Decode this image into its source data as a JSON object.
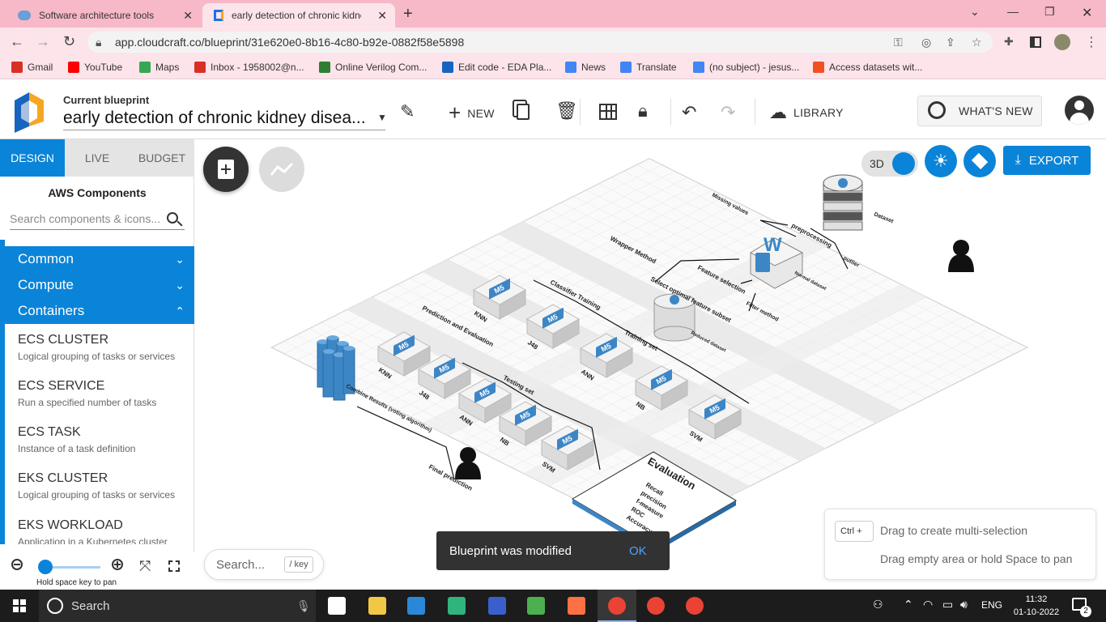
{
  "browser": {
    "tabs": [
      {
        "title": "Software architecture tools",
        "active": false
      },
      {
        "title": "early detection of chronic kidney",
        "active": true
      }
    ],
    "url": "app.cloudcraft.co/blueprint/31e620e0-8b16-4c80-b92e-0882f58e5898",
    "bookmarks": [
      {
        "label": "Gmail",
        "color": "#d93025"
      },
      {
        "label": "YouTube",
        "color": "#ff0000"
      },
      {
        "label": "Maps",
        "color": "#34a853"
      },
      {
        "label": "Inbox - 1958002@n...",
        "color": "#d93025"
      },
      {
        "label": "Online Verilog Com...",
        "color": "#2e7d32"
      },
      {
        "label": "Edit code - EDA Pla...",
        "color": "#1565c0"
      },
      {
        "label": "News",
        "color": "#4285f4"
      },
      {
        "label": "Translate",
        "color": "#4285f4"
      },
      {
        "label": "(no subject) - jesus...",
        "color": "#4285f4"
      },
      {
        "label": "Access datasets wit...",
        "color": "#f25022"
      }
    ]
  },
  "header": {
    "blueprint_label": "Current blueprint",
    "blueprint_title": "early detection of chronic kidney disea...",
    "new_label": "NEW",
    "library_label": "LIBRARY",
    "whats_new_label": "WHAT'S NEW"
  },
  "sidebar": {
    "tabs": [
      "DESIGN",
      "LIVE",
      "BUDGET"
    ],
    "active_tab": "DESIGN",
    "title": "AWS Components",
    "search_placeholder": "Search components & icons...",
    "categories": [
      {
        "label": "Common",
        "expanded": false
      },
      {
        "label": "Compute",
        "expanded": false
      },
      {
        "label": "Containers",
        "expanded": true
      }
    ],
    "items": [
      {
        "name": "ECS CLUSTER",
        "desc": "Logical grouping of tasks or services"
      },
      {
        "name": "ECS SERVICE",
        "desc": "Run a specified number of tasks"
      },
      {
        "name": "ECS TASK",
        "desc": "Instance of a task definition"
      },
      {
        "name": "EKS CLUSTER",
        "desc": "Logical grouping of tasks or services"
      },
      {
        "name": "EKS WORKLOAD",
        "desc": "Application in a Kubernetes cluster"
      }
    ],
    "zoom_hint": "Hold space key to pan",
    "zoom_level": 0.0
  },
  "canvas": {
    "toggle_label": "3D",
    "export_label": "EXPORT",
    "search_placeholder": "Search...",
    "search_key": "/ key",
    "toast_message": "Blueprint was modified",
    "toast_action": "OK",
    "hint_key": "Ctrl +",
    "hint_line1": "Drag to create multi-selection",
    "hint_line2": "Drag empty area or hold Space to pan",
    "diagram": {
      "labels": {
        "dataset": "Dataset",
        "missing": "Missing values",
        "preprocessing": "preprocessing",
        "outlier": "outlier",
        "normal": "Normal dataset",
        "wrapper": "Wrapper Method",
        "feature_selection": "Feature selection",
        "select_optimal": "Select optimal feature subset",
        "filter": "Filter method",
        "reduced": "Reduced dataset",
        "classifier_training": "Classifier Training",
        "training_set": "Training set",
        "prediction_eval": "Prediction and Evaluation",
        "testing_set": "Testing set",
        "combine": "Combine Results (voting algorithm)",
        "final": "Final prediction",
        "evaluation": "Evaluation",
        "metrics": [
          "Recall",
          "precision",
          "f-measure",
          "ROC",
          "Accuracy"
        ],
        "m5": "M5"
      },
      "train_models": [
        "KNN",
        "J48",
        "ANN",
        "NB",
        "SVM"
      ],
      "test_models": [
        "KNN",
        "J48",
        "ANN",
        "NB",
        "SVM"
      ]
    }
  },
  "taskbar": {
    "search_placeholder": "Search",
    "language": "ENG",
    "time": "11:32",
    "date": "01-10-2022",
    "notification_count": "2"
  }
}
